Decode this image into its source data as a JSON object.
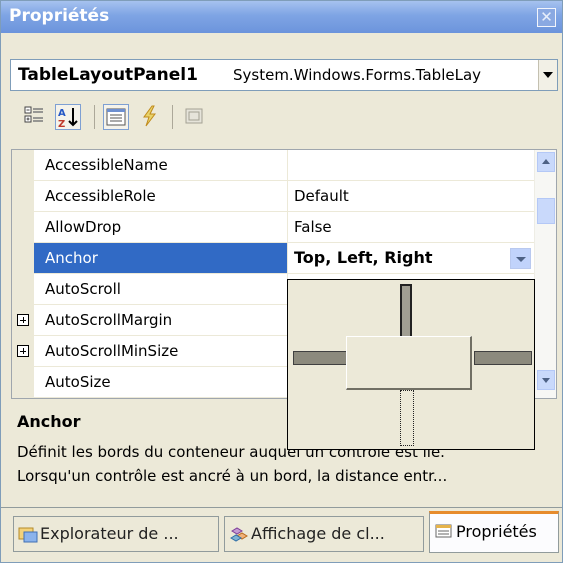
{
  "window": {
    "title": "Propriétés",
    "close_glyph": "✕"
  },
  "object_selector": {
    "name": "TableLayoutPanel1",
    "type": "System.Windows.Forms.TableLay"
  },
  "toolbar": {
    "buttons": [
      {
        "icon": "categorized-icon",
        "pressed": false
      },
      {
        "icon": "alphabetical-icon",
        "pressed": true
      },
      {
        "icon": "properties-icon",
        "pressed": true
      },
      {
        "icon": "events-icon",
        "pressed": false
      },
      {
        "icon": "property-pages-icon",
        "pressed": false
      }
    ]
  },
  "grid": {
    "rows": [
      {
        "name": "AccessibleName",
        "value": "",
        "expandable": false
      },
      {
        "name": "AccessibleRole",
        "value": "Default",
        "expandable": false
      },
      {
        "name": "AllowDrop",
        "value": "False",
        "expandable": false
      },
      {
        "name": "Anchor",
        "value": "Top, Left, Right",
        "expandable": false,
        "selected": true
      },
      {
        "name": "AutoScroll",
        "value": "",
        "expandable": false
      },
      {
        "name": "AutoScrollMargin",
        "value": "",
        "expandable": true
      },
      {
        "name": "AutoScrollMinSize",
        "value": "",
        "expandable": true
      },
      {
        "name": "AutoSize",
        "value": "",
        "expandable": false
      }
    ]
  },
  "anchor_editor": {
    "top": true,
    "left": true,
    "right": true,
    "bottom": false
  },
  "description": {
    "title": "Anchor",
    "line1": "Définit les bords du conteneur auquel un contrôle est lié.",
    "line2": "Lorsqu'un contrôle est ancré à un bord, la distance entr..."
  },
  "tabs": [
    {
      "label": "Explorateur de ...",
      "active": false,
      "icon": "solution-explorer-icon"
    },
    {
      "label": "Affichage de cl...",
      "active": false,
      "icon": "class-view-icon"
    },
    {
      "label": "Propriétés",
      "active": true,
      "icon": "properties-tab-icon"
    }
  ],
  "colors": {
    "accent": "#316ac5",
    "title_bar": "#7ea4e4",
    "active_tab": "#e68b2c"
  }
}
